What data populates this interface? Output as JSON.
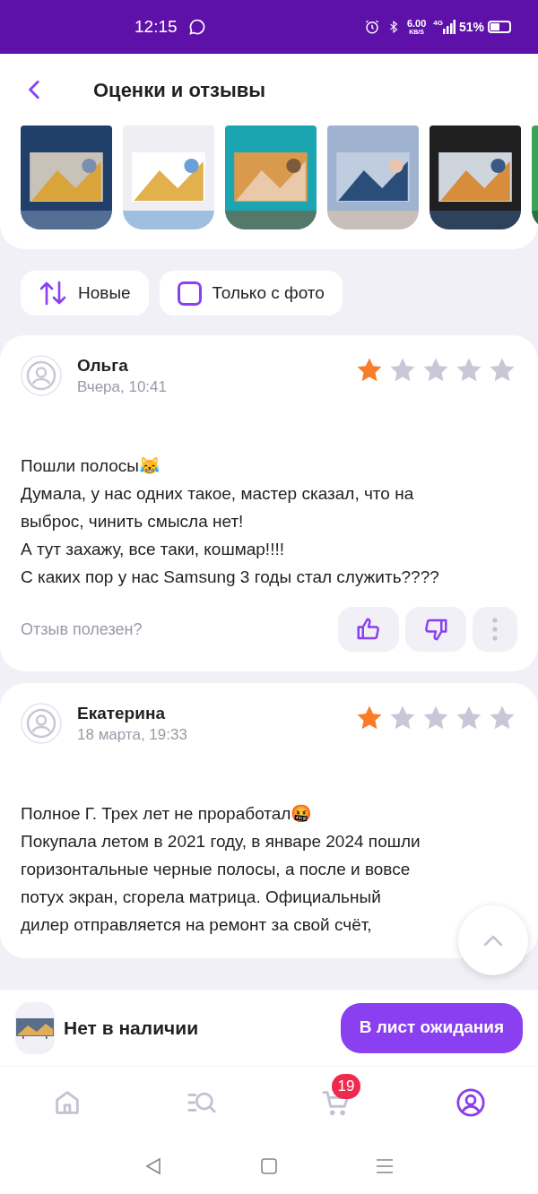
{
  "status_bar": {
    "time": "12:15",
    "speed": "6.00",
    "speed_unit": "KB/S",
    "network": "4G",
    "battery": "51%"
  },
  "header": {
    "title": "Оценки и отзывы"
  },
  "filters": [
    {
      "kind": "sort",
      "label": "Новые"
    },
    {
      "kind": "checkbox",
      "label": "Только с фото",
      "checked": false
    }
  ],
  "reviews": [
    {
      "author": "Ольга",
      "date": "Вчера, 10:41",
      "stars": 1,
      "lines": [
        "Пошли полосы😹",
        "Думала, у нас одних такое, мастер сказал, что на",
        "выброс, чинить смысла нет!",
        "А тут захажу, все таки, кошмар!!!!",
        "С каких пор у нас Samsung 3 годы стал служить????"
      ],
      "helpful": "Отзыв полезен?"
    },
    {
      "author": "Екатерина",
      "date": "18 марта, 19:33",
      "stars": 1,
      "lines": [
        "Полное Г. Трех лет не проработал🤬",
        "Покупала летом в 2021 году, в январе 2024 пошли",
        "горизонтальные черные полосы, а после и вовсе",
        "потух экран, сгорела матрица. Официальный",
        "дилер отправляется на ремонт за свой счёт,"
      ]
    }
  ],
  "product_bar": {
    "status": "Нет в наличии",
    "button": "В лист ожидания"
  },
  "nav": [
    {
      "kind": "home",
      "selected": false
    },
    {
      "kind": "catalog",
      "selected": false
    },
    {
      "kind": "cart",
      "selected": false,
      "badge": "19"
    },
    {
      "kind": "profile",
      "selected": true
    }
  ]
}
